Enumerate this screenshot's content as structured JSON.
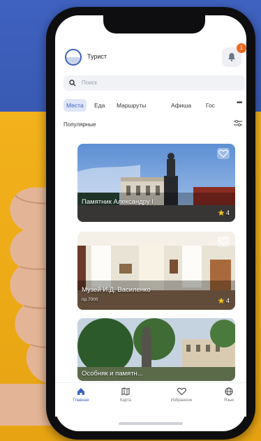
{
  "app": {
    "title": "Турист",
    "notification_count": "1"
  },
  "search": {
    "placeholder": "Поиск"
  },
  "tabs": [
    {
      "label": "Места",
      "active": true
    },
    {
      "label": "Еда",
      "active": false
    },
    {
      "label": "Маршруты",
      "active": false
    },
    {
      "label": "Афиша",
      "active": false
    },
    {
      "label": "Гос",
      "active": false
    }
  ],
  "tabs_more": "•••",
  "section": {
    "title": "Популярные"
  },
  "cards": [
    {
      "title": "Памятник Александру I",
      "subtitle": "",
      "rating": "4"
    },
    {
      "title": "Музей И.Д. Василенко",
      "subtitle": "пр.7000",
      "rating": "4"
    },
    {
      "title": "Особняк и памятн...",
      "subtitle": "",
      "rating": ""
    }
  ],
  "nav": [
    {
      "label": "Главная",
      "icon": "home-icon",
      "active": true
    },
    {
      "label": "Карта",
      "icon": "map-icon",
      "active": false
    },
    {
      "label": "Избранное",
      "icon": "heart-icon",
      "active": false
    },
    {
      "label": "Язык",
      "icon": "globe-icon",
      "active": false
    }
  ],
  "colors": {
    "accent": "#3c64c4",
    "badge": "#ef6a1f",
    "bg_blue": "#3f62c0",
    "bg_yellow": "#f2b21c"
  }
}
